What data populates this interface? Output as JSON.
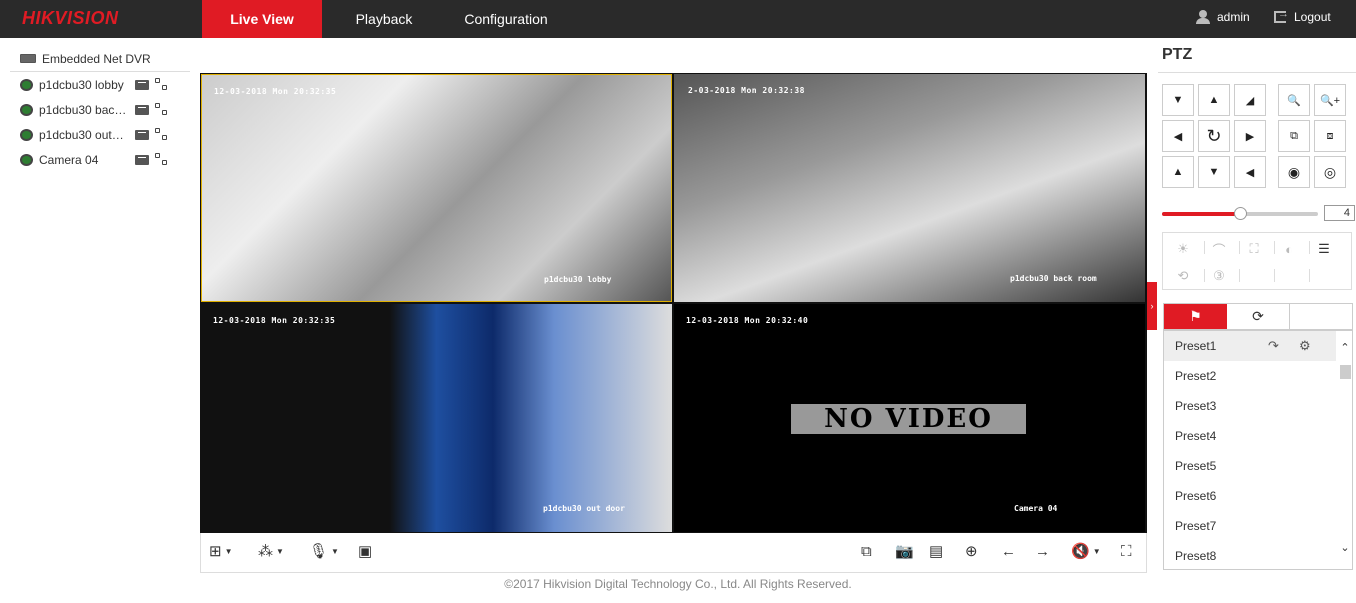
{
  "header": {
    "logo": "HIKVISION",
    "tabs": [
      "Live View",
      "Playback",
      "Configuration"
    ],
    "active_tab": "Live View",
    "user": "admin",
    "logout": "Logout",
    "accent_color": "#e01b24"
  },
  "device_tree": {
    "device": "Embedded Net DVR",
    "cameras": [
      {
        "label": "p1dcbu30 lobby"
      },
      {
        "label": "p1dcbu30 bac…"
      },
      {
        "label": "p1dcbu30 out…"
      },
      {
        "label": "Camera 04"
      }
    ]
  },
  "video": {
    "tiles": [
      {
        "timestamp": "12-03-2018 Mon 20:32:35",
        "name": "p1dcbu30 lobby"
      },
      {
        "timestamp": "2-03-2018 Mon 20:32:38",
        "name": "p1dcbu30 back room"
      },
      {
        "timestamp": "12-03-2018 Mon 20:32:35",
        "name": "p1dcbu30 out door"
      },
      {
        "timestamp": "12-03-2018 Mon 20:32:40",
        "name": "Camera 04",
        "overlay": "NO VIDEO"
      }
    ]
  },
  "footer": "©2017 Hikvision Digital Technology Co., Ltd. All Rights Reserved.",
  "ptz": {
    "title": "PTZ",
    "speed": "4",
    "speed_fraction": 0.5,
    "tabs": [
      "preset-flag-icon",
      "patrol-cycle-icon",
      "pattern"
    ],
    "presets": [
      "Preset1",
      "Preset2",
      "Preset3",
      "Preset4",
      "Preset5",
      "Preset6",
      "Preset7",
      "Preset8"
    ],
    "selected_preset": "Preset1"
  }
}
